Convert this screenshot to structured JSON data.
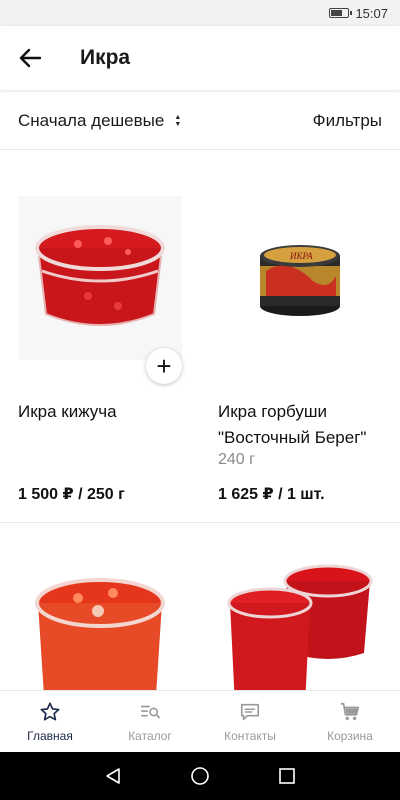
{
  "status_bar": {
    "time": "15:07"
  },
  "header": {
    "title": "Икра",
    "back_icon": "arrow-left-icon"
  },
  "sort_bar": {
    "sort_label": "Сначала дешевые",
    "filters_label": "Фильтры"
  },
  "products": [
    {
      "name": "Икра кижуча",
      "weight": "",
      "price": "1 500 ₽ / 250 г"
    },
    {
      "name": "Икра горбуши \"Восточный Берег\"",
      "weight": "240 г",
      "price": "1 625 ₽ / 1 шт."
    }
  ],
  "bottom_nav": {
    "items": [
      {
        "label": "Главная",
        "icon": "star-icon",
        "active": true
      },
      {
        "label": "Каталог",
        "icon": "catalog-icon",
        "active": false
      },
      {
        "label": "Контакты",
        "icon": "chat-icon",
        "active": false
      },
      {
        "label": "Корзина",
        "icon": "cart-icon",
        "active": false
      }
    ]
  },
  "colors": {
    "accent": "#1e2a4a",
    "inactive": "#9a9a9a",
    "caviar": "#d8141a"
  }
}
